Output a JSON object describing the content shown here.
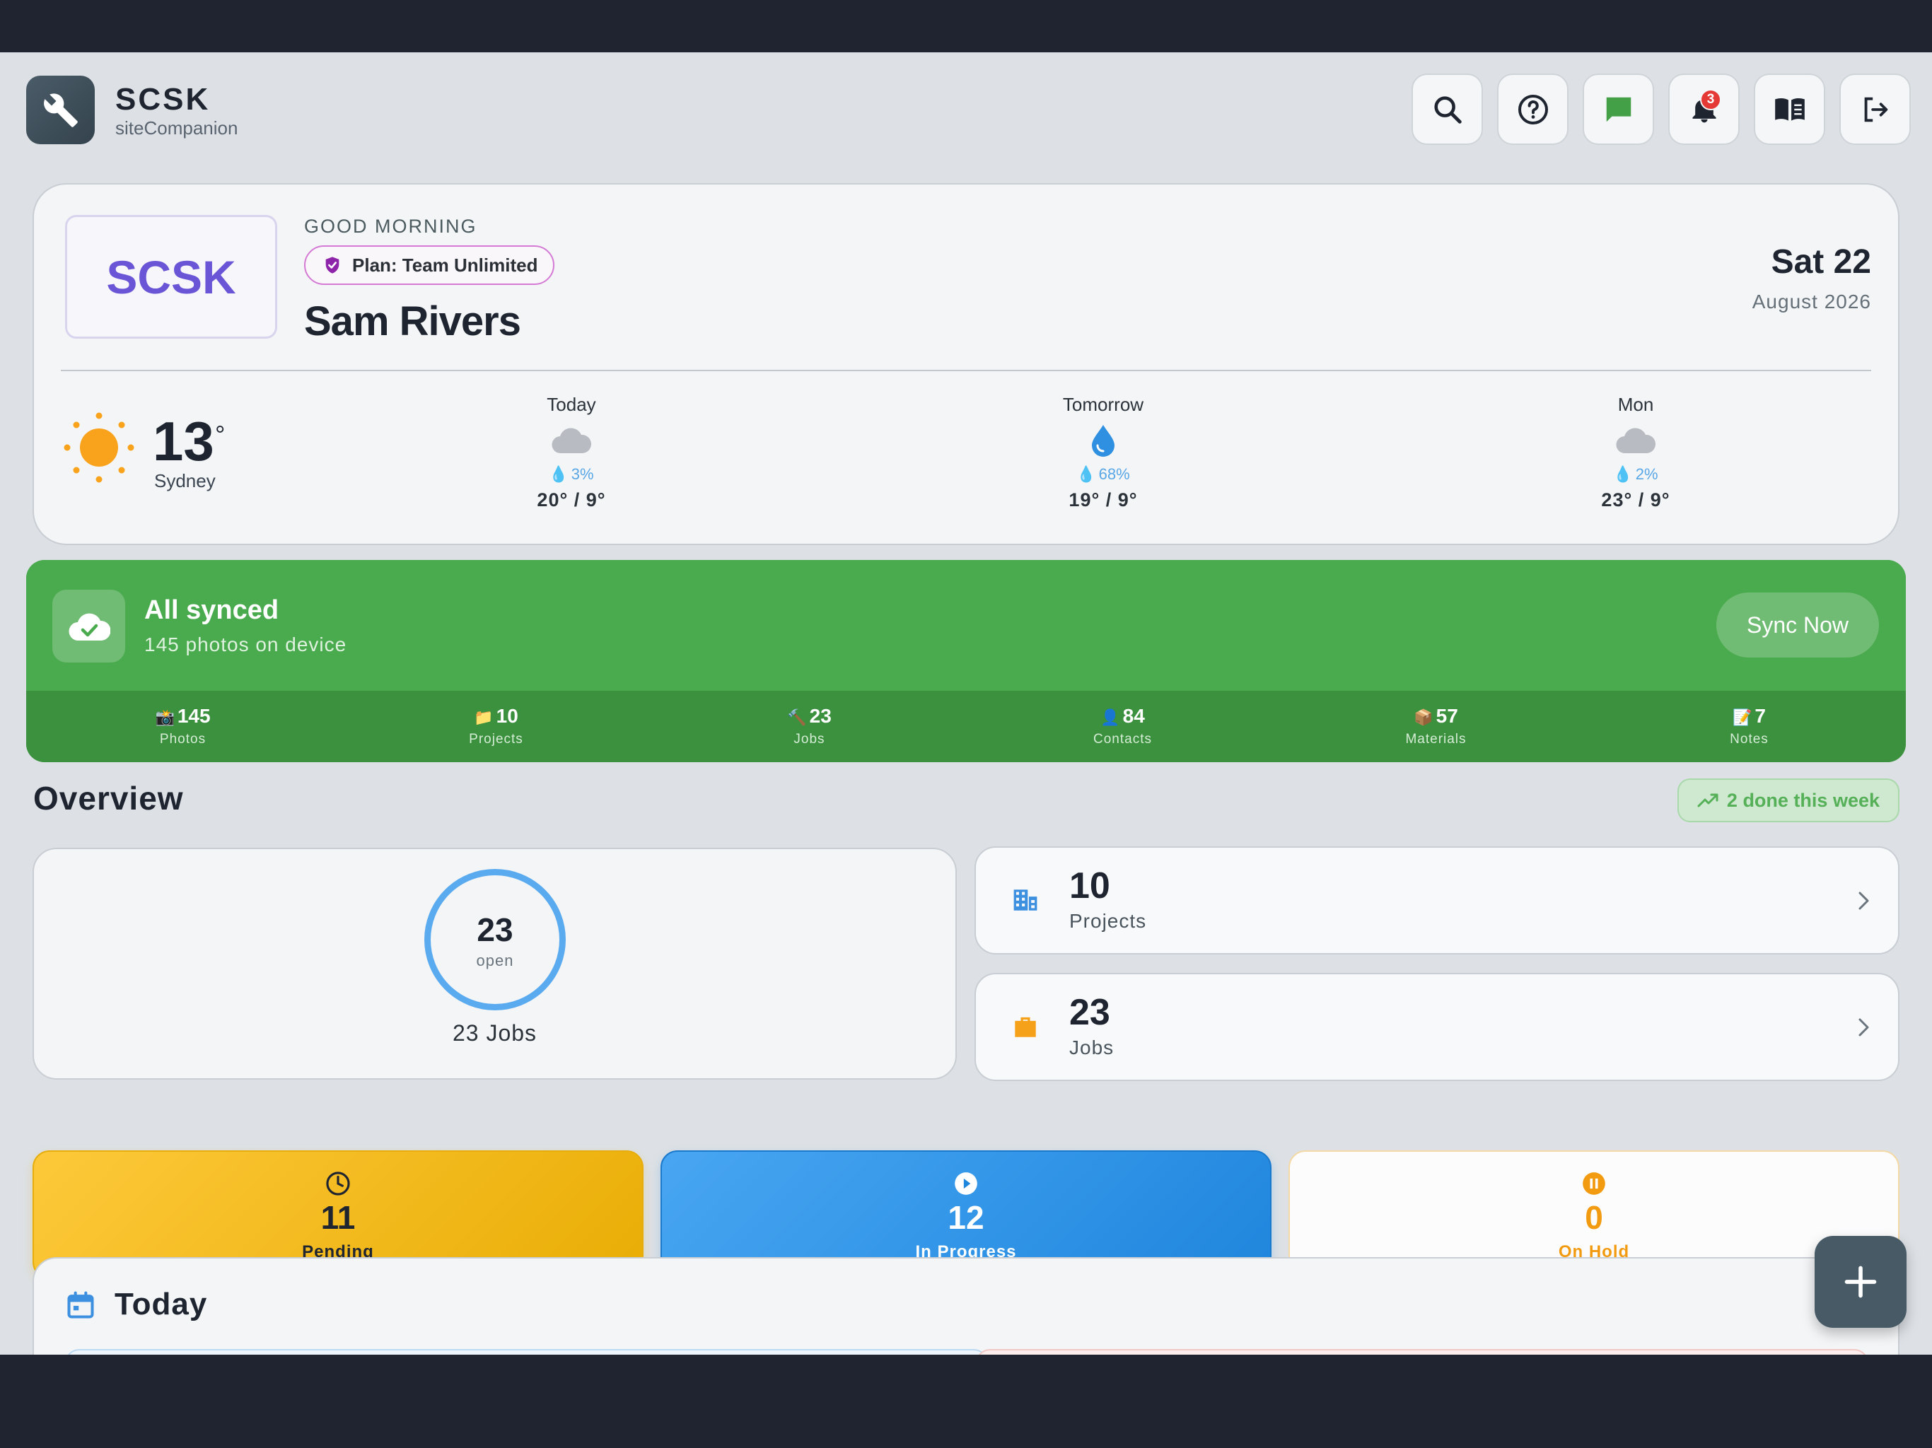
{
  "app": {
    "title": "SCSK",
    "subtitle": "siteCompanion"
  },
  "header": {
    "notification_count": "3",
    "buttons": [
      "search-icon",
      "help-icon",
      "chat-icon",
      "bell-icon",
      "book-icon",
      "logout-icon"
    ]
  },
  "welcome": {
    "org_logo_text": "SCSK",
    "greeting": "GOOD MORNING",
    "plan": "Plan: Team Unlimited",
    "user_name": "Sam Rivers",
    "date_main": "Sat 22",
    "date_sub": "August 2026"
  },
  "weather": {
    "current_temp": "13",
    "degree_symbol": "°",
    "city": "Sydney",
    "forecast": [
      {
        "day": "Today",
        "icon": "cloud-icon",
        "rain": "3%",
        "range": "20° / 9°"
      },
      {
        "day": "Tomorrow",
        "icon": "raindrop-icon",
        "rain": "68%",
        "range": "19° / 9°"
      },
      {
        "day": "Mon",
        "icon": "cloud-icon",
        "rain": "2%",
        "range": "23° / 9°"
      }
    ]
  },
  "sync": {
    "title": "All synced",
    "subtitle": "145 photos on device",
    "button": "Sync Now",
    "stats": [
      {
        "emoji": "📸",
        "value": "145",
        "label": "Photos"
      },
      {
        "emoji": "📁",
        "value": "10",
        "label": "Projects"
      },
      {
        "emoji": "🔨",
        "value": "23",
        "label": "Jobs"
      },
      {
        "emoji": "👤",
        "value": "84",
        "label": "Contacts"
      },
      {
        "emoji": "📦",
        "value": "57",
        "label": "Materials"
      },
      {
        "emoji": "📝",
        "value": "7",
        "label": "Notes"
      }
    ]
  },
  "overview": {
    "title": "Overview",
    "done_pill": "2 done this week",
    "ring_value": "23",
    "ring_label": "open",
    "jobs_caption": "23 Jobs",
    "projects": {
      "value": "10",
      "label": "Projects"
    },
    "jobs": {
      "value": "23",
      "label": "Jobs"
    },
    "statuses": [
      {
        "value": "11",
        "label": "Pending"
      },
      {
        "value": "12",
        "label": "In Progress"
      },
      {
        "value": "0",
        "label": "On Hold"
      }
    ]
  },
  "today": {
    "title": "Today"
  },
  "colors": {
    "sync_green": "#4aaa4e",
    "accent_blue": "#5aaaf0",
    "pending_yellow": "#fdc93a",
    "progress_blue": "#1f86dd",
    "hold_orange": "#f29a10"
  }
}
